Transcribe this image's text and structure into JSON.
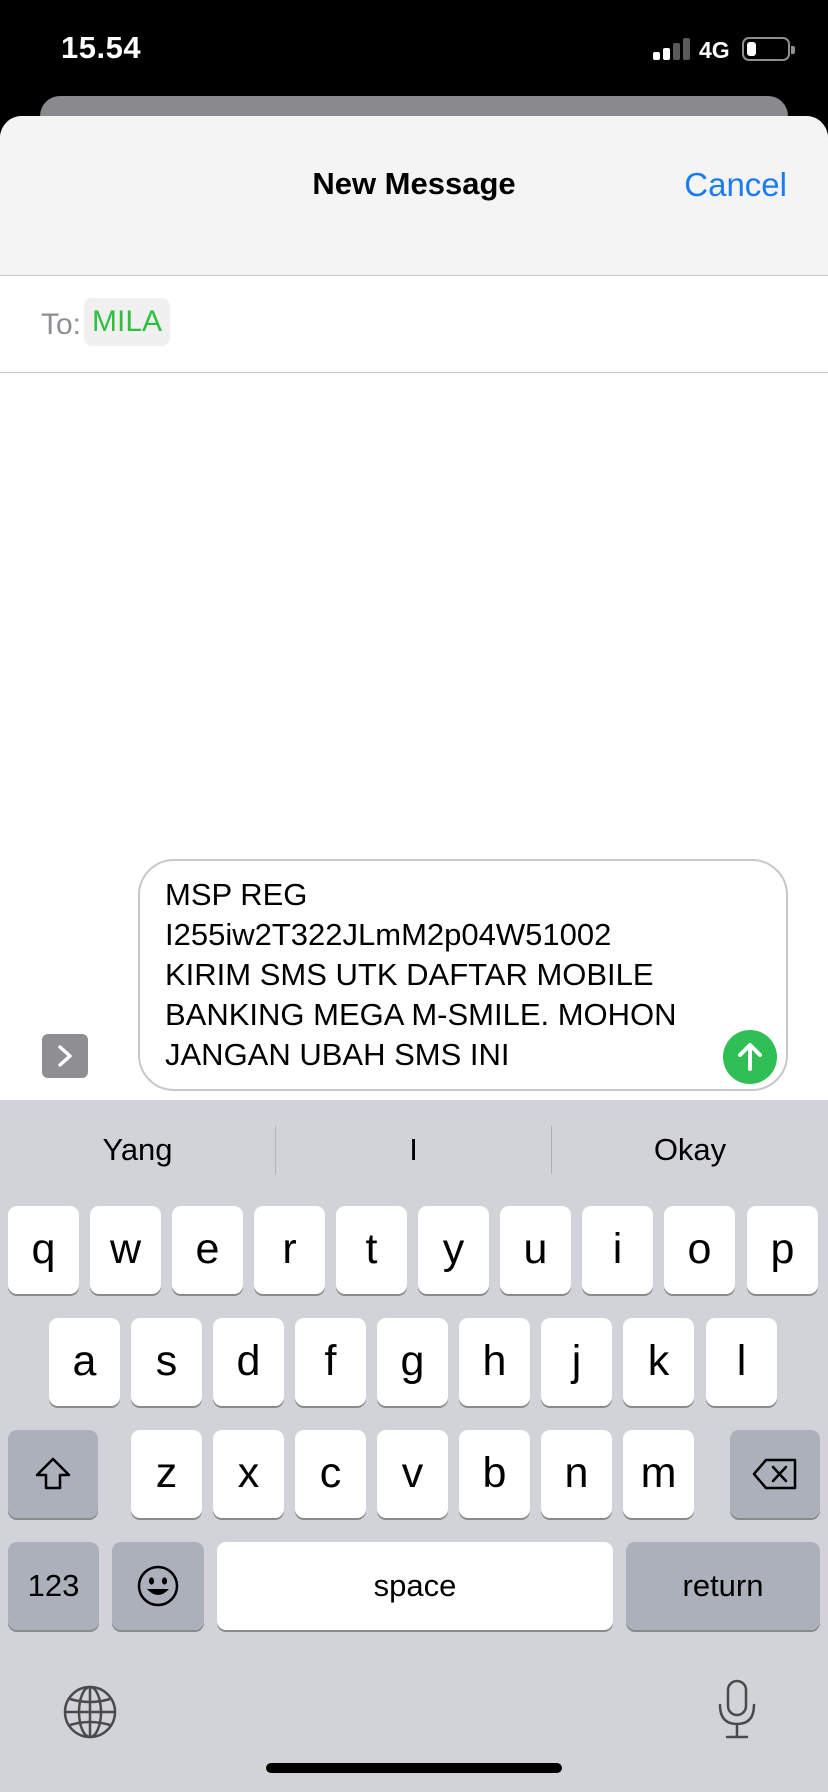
{
  "status_bar": {
    "time": "15.54",
    "network": "4G"
  },
  "header": {
    "title": "New Message",
    "cancel_label": "Cancel",
    "accent_color": "#1a7cf0"
  },
  "to_field": {
    "label": "To:",
    "recipient": "MILA",
    "recipient_color": "#2fbf3c"
  },
  "compose": {
    "message": "MSP REG\nI255iw2T322JLmM2p04W51002\nKIRIM SMS UTK DAFTAR MOBILE\nBANKING MEGA M-SMILE. MOHON\nJANGAN UBAH SMS INI",
    "send_color": "#2fbf55"
  },
  "keyboard": {
    "suggestions": [
      "Yang",
      "I",
      "Okay"
    ],
    "row1": [
      "q",
      "w",
      "e",
      "r",
      "t",
      "y",
      "u",
      "i",
      "o",
      "p"
    ],
    "row2": [
      "a",
      "s",
      "d",
      "f",
      "g",
      "h",
      "j",
      "k",
      "l"
    ],
    "row3": [
      "z",
      "x",
      "c",
      "v",
      "b",
      "n",
      "m"
    ],
    "numbers_label": "123",
    "space_label": "space",
    "return_label": "return"
  },
  "icons": {
    "signal": "cellular-signal-icon",
    "battery": "battery-icon",
    "expand": "chevron-right-icon",
    "send": "arrow-up-icon",
    "shift": "shift-icon",
    "backspace": "backspace-icon",
    "emoji": "emoji-icon",
    "globe": "globe-icon",
    "mic": "microphone-icon"
  }
}
